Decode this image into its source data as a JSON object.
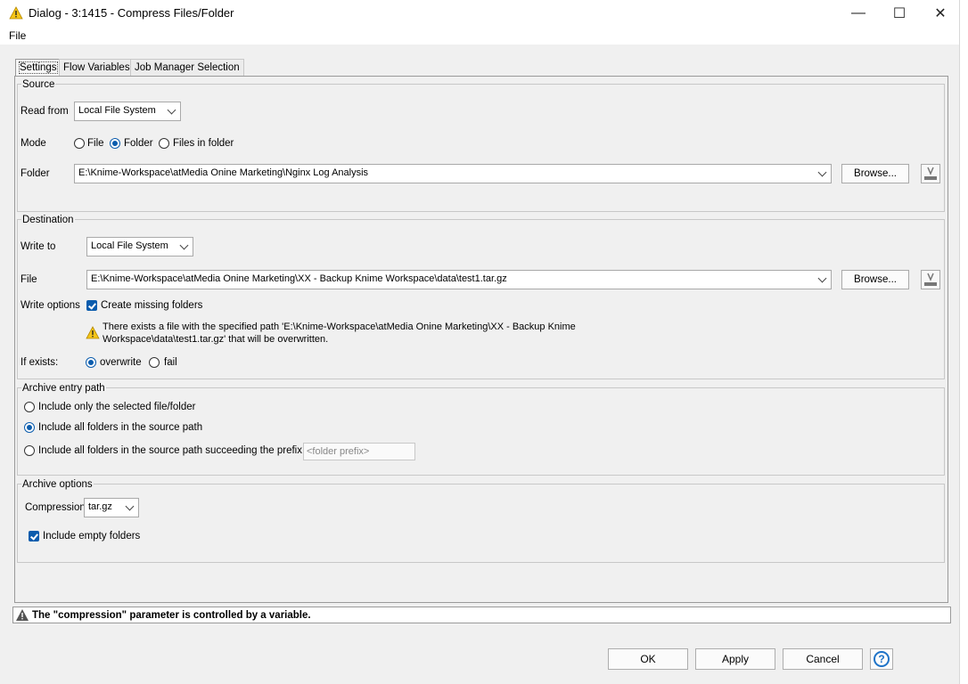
{
  "window": {
    "title": "Dialog - 3:1415 - Compress Files/Folder",
    "minimize": "—",
    "maximize": "☐",
    "close": "✕"
  },
  "menu": {
    "file": "File"
  },
  "tabs": [
    "Settings",
    "Flow Variables",
    "Job Manager Selection"
  ],
  "source": {
    "legend": "Source",
    "read_from_label": "Read from",
    "read_from_value": "Local File System",
    "mode_label": "Mode",
    "mode_options": [
      "File",
      "Folder",
      "Files in folder"
    ],
    "mode_selected": "Folder",
    "folder_label": "Folder",
    "folder_value": "E:\\Knime-Workspace\\atMedia Onine Marketing\\Nginx Log Analysis",
    "browse_label": "Browse..."
  },
  "destination": {
    "legend": "Destination",
    "write_to_label": "Write to",
    "write_to_value": "Local File System",
    "file_label": "File",
    "file_value": "E:\\Knime-Workspace\\atMedia Onine Marketing\\XX - Backup Knime Workspace\\data\\test1.tar.gz",
    "browse_label": "Browse...",
    "write_options_label": "Write options",
    "create_missing_label": "Create missing folders",
    "create_missing_checked": true,
    "warning_line1": "There exists a file with the specified path 'E:\\Knime-Workspace\\atMedia Onine Marketing\\XX - Backup Knime",
    "warning_line2": "Workspace\\data\\test1.tar.gz' that will be overwritten.",
    "if_exists_label": "If exists:",
    "if_exists_options": [
      "overwrite",
      "fail"
    ],
    "if_exists_selected": "overwrite"
  },
  "archive_entry": {
    "legend": "Archive entry path",
    "options": [
      "Include only the selected file/folder",
      "Include all folders in the source path",
      "Include all folders in the source path succeeding the prefix"
    ],
    "selected": "Include all folders in the source path",
    "prefix_placeholder": "<folder prefix>"
  },
  "archive_options": {
    "legend": "Archive options",
    "compression_label": "Compression",
    "compression_value": "tar.gz",
    "include_empty_label": "Include empty folders",
    "include_empty_checked": true
  },
  "status": {
    "message": "The \"compression\" parameter is controlled by a variable."
  },
  "buttons": {
    "ok": "OK",
    "apply": "Apply",
    "cancel": "Cancel",
    "help": "?"
  },
  "colors": {
    "accent": "#0b5cad",
    "warning": "#f5c518",
    "help": "#1e73c8"
  }
}
